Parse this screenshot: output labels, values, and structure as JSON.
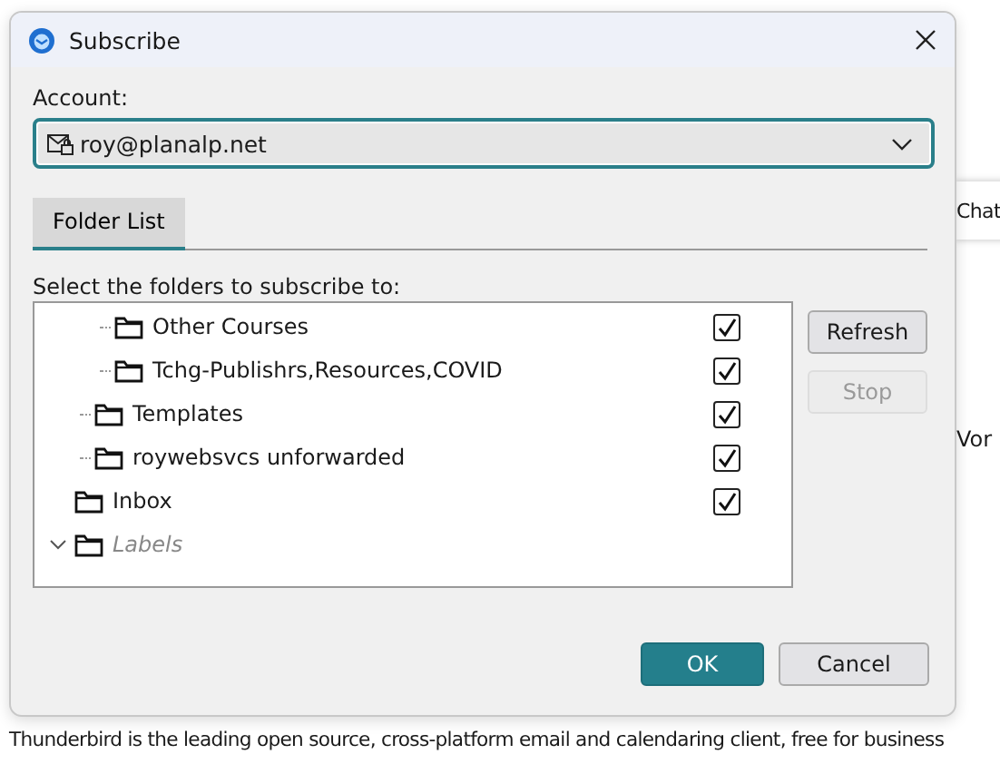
{
  "background": {
    "side_tab": "Chat",
    "side_text": "Vor",
    "footer_text": "Thunderbird is the leading open source, cross-platform email and calendaring client, free for business"
  },
  "window": {
    "title": "Subscribe"
  },
  "account": {
    "label": "Account:",
    "value": "roy@planalp.net"
  },
  "tabs": [
    {
      "label": "Folder List",
      "selected": true
    }
  ],
  "folder_prompt": "Select the folders to subscribe to:",
  "folders": [
    {
      "children": [
        {
          "children": [
            {
              "label": "Other Courses",
              "kind": "folder",
              "checked": true
            },
            {
              "label": "Tchg-Publishrs,Resources,COVID",
              "kind": "folder",
              "checked": true
            }
          ]
        },
        {
          "label": "Templates",
          "kind": "folder",
          "checked": true
        },
        {
          "label": "roywebsvcs unforwarded",
          "kind": "folder",
          "checked": true
        }
      ]
    },
    {
      "label": "Inbox",
      "kind": "folder",
      "checked": true
    },
    {
      "label": "Labels",
      "kind": "group",
      "expanded": true
    }
  ],
  "side_buttons": [
    {
      "label": "Refresh",
      "disabled": false
    },
    {
      "label": "Stop",
      "disabled": true
    }
  ],
  "buttons": [
    {
      "label": "OK",
      "kind": "primary"
    },
    {
      "label": "Cancel",
      "kind": "secondary"
    }
  ]
}
